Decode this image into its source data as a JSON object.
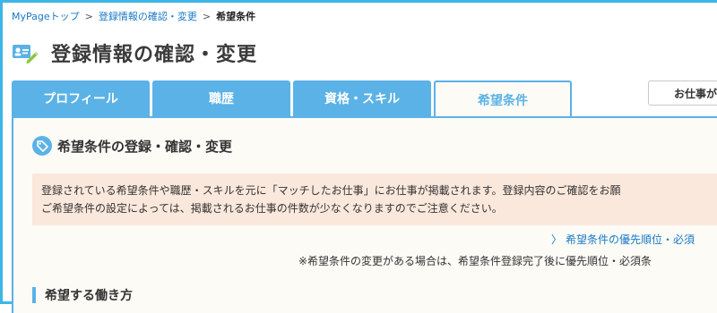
{
  "breadcrumb": {
    "items": [
      {
        "label": "MyPageトップ"
      },
      {
        "label": "登録情報の確認・変更"
      },
      {
        "label": "希望条件"
      }
    ],
    "separator": ">"
  },
  "page": {
    "title": "登録情報の確認・変更",
    "icon": "profile-card-edit-icon"
  },
  "tabs": [
    {
      "label": "プロフィール"
    },
    {
      "label": "職歴"
    },
    {
      "label": "資格・スキル"
    },
    {
      "label": "希望条件",
      "active": true
    }
  ],
  "side_button": {
    "label": "お仕事が"
  },
  "section": {
    "title": "希望条件の登録・確認・変更",
    "icon": "tag-icon"
  },
  "notice": {
    "line1": "登録されている希望条件や職歴・スキルを元に「マッチしたお仕事」にお仕事が掲載されます。登録内容のご確認をお願",
    "line2": "ご希望条件の設定によっては、掲載されるお仕事の件数が少なくなりますのでご注意ください。"
  },
  "priority_link": {
    "label": "希望条件の優先順位・必須"
  },
  "note": "※希望条件の変更がある場合は、希望条件登録完了後に優先順位・必須条",
  "subsection": {
    "title": "希望する働き方"
  },
  "colors": {
    "accent": "#5ab2e6",
    "frame": "#3bb6e6",
    "notice_bg": "#fbe8dc",
    "link": "#1a79c6"
  }
}
